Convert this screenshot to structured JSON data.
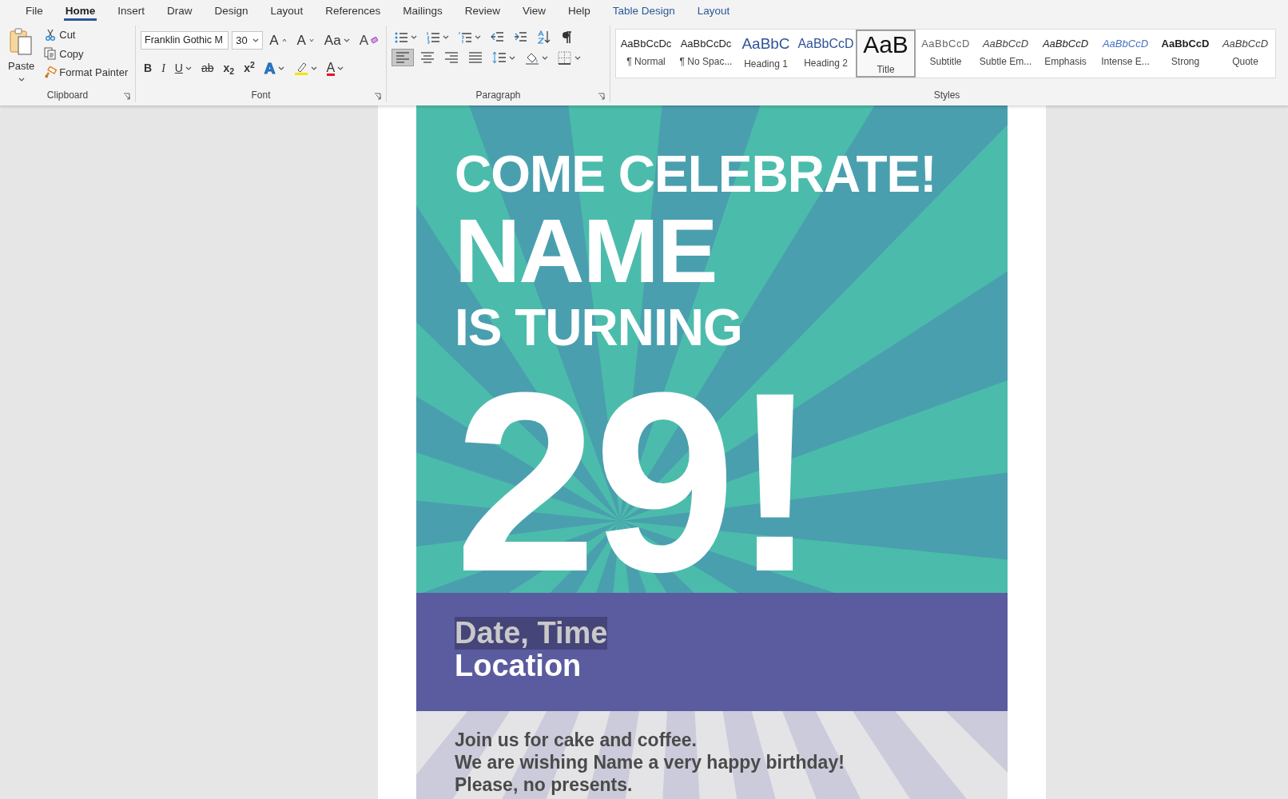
{
  "tabs": [
    {
      "label": "File",
      "selected": false,
      "kind": "main"
    },
    {
      "label": "Home",
      "selected": true,
      "kind": "main"
    },
    {
      "label": "Insert",
      "selected": false,
      "kind": "main"
    },
    {
      "label": "Draw",
      "selected": false,
      "kind": "main"
    },
    {
      "label": "Design",
      "selected": false,
      "kind": "main"
    },
    {
      "label": "Layout",
      "selected": false,
      "kind": "main"
    },
    {
      "label": "References",
      "selected": false,
      "kind": "main"
    },
    {
      "label": "Mailings",
      "selected": false,
      "kind": "main"
    },
    {
      "label": "Review",
      "selected": false,
      "kind": "main"
    },
    {
      "label": "View",
      "selected": false,
      "kind": "main"
    },
    {
      "label": "Help",
      "selected": false,
      "kind": "main"
    },
    {
      "label": "Table Design",
      "selected": false,
      "kind": "contextual"
    },
    {
      "label": "Layout",
      "selected": false,
      "kind": "contextual"
    }
  ],
  "clipboard": {
    "title": "Clipboard",
    "paste": "Paste",
    "items": [
      {
        "label": "Cut",
        "kind": "cut"
      },
      {
        "label": "Copy",
        "kind": "copy"
      },
      {
        "label": "Format Painter",
        "kind": "painter"
      }
    ]
  },
  "font": {
    "title": "Font",
    "family": "Franklin Gothic M",
    "size": "30",
    "top_buttons": [
      {
        "label": "A",
        "kind": "grow"
      },
      {
        "label": "A",
        "kind": "shrink"
      },
      {
        "label": "Aa",
        "kind": "case"
      },
      {
        "label": "A",
        "kind": "clear"
      }
    ],
    "buttons": [
      {
        "label": "B",
        "kind": "bold"
      },
      {
        "label": "I",
        "kind": "italic"
      },
      {
        "label": "U",
        "kind": "underline"
      },
      {
        "label": "ab",
        "kind": "strike"
      },
      {
        "label": "x$_{2}$",
        "kind": "sub"
      },
      {
        "label": "x$^{2}$",
        "kind": "sup"
      },
      {
        "label": "A",
        "kind": "effects"
      },
      {
        "kind": "highlight"
      },
      {
        "label": "A",
        "kind": "color"
      }
    ]
  },
  "paragraph": {
    "title": "Paragraph",
    "alignments": [
      {
        "kind": "left",
        "selected": true
      },
      {
        "kind": "center",
        "selected": false
      },
      {
        "kind": "right",
        "selected": false
      },
      {
        "kind": "justify",
        "selected": false
      }
    ]
  },
  "styles": {
    "title": "Styles",
    "items": [
      {
        "preview": "AaBbCcDc",
        "label": "¶ Normal",
        "kind": "normal",
        "selected": false
      },
      {
        "preview": "AaBbCcDc",
        "label": "¶ No Spac...",
        "kind": "normal",
        "selected": false
      },
      {
        "preview": "AaBbC",
        "label": "Heading 1",
        "kind": "heading1",
        "selected": false
      },
      {
        "preview": "AaBbCcD",
        "label": "Heading 2",
        "kind": "heading2",
        "selected": false
      },
      {
        "preview": "AaB",
        "label": "Title",
        "kind": "title",
        "selected": true
      },
      {
        "preview": "AaBbCcD",
        "label": "Subtitle",
        "kind": "subtitle",
        "selected": false
      },
      {
        "preview": "AaBbCcD",
        "label": "Subtle Em...",
        "kind": "subtle",
        "selected": false
      },
      {
        "preview": "AaBbCcD",
        "label": "Emphasis",
        "kind": "emphasis",
        "selected": false
      },
      {
        "preview": "AaBbCcD",
        "label": "Intense E...",
        "kind": "intense",
        "selected": false
      },
      {
        "preview": "AaBbCcD",
        "label": "Strong",
        "kind": "strong",
        "selected": false
      },
      {
        "preview": "AaBbCcD",
        "label": "Quote",
        "kind": "quote",
        "selected": false
      }
    ]
  },
  "document": {
    "headline": [
      {
        "text": "COME CELEBRATE!",
        "kind": "kicker"
      },
      {
        "text": "NAME",
        "kind": "name"
      },
      {
        "text": "IS TURNING",
        "kind": "kicker"
      },
      {
        "text": "29!",
        "kind": "age"
      }
    ],
    "details": [
      {
        "text": "Date, Time",
        "selected": true
      },
      {
        "text": "Location",
        "selected": false
      }
    ],
    "notes": [
      "Join us for cake and coffee.",
      "We are wishing Name a very happy birthday!",
      "Please, no presents."
    ]
  }
}
